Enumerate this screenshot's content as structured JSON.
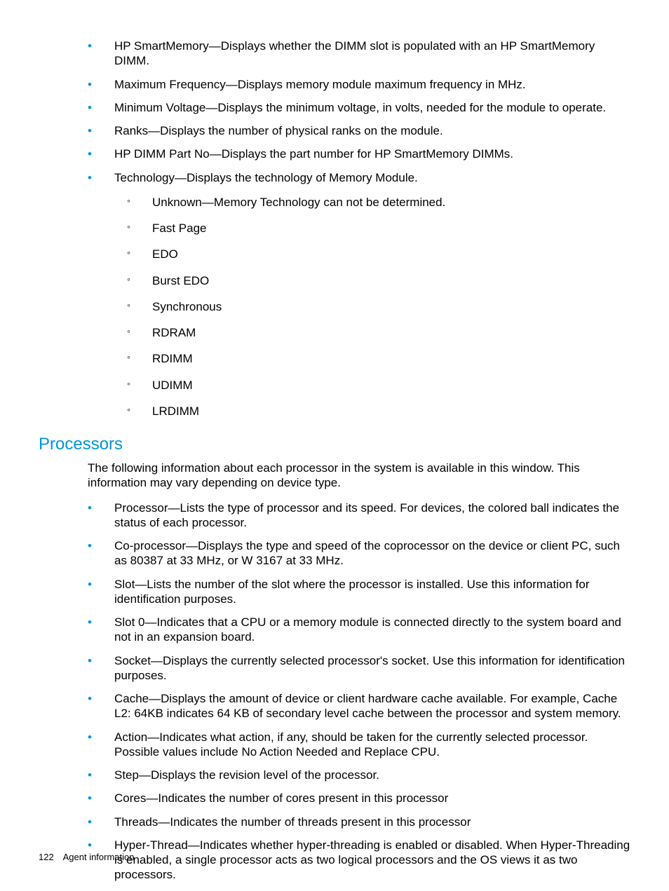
{
  "section1_items": [
    "HP SmartMemory—Displays whether the DIMM slot is populated with an HP SmartMemory DIMM.",
    "Maximum Frequency—Displays memory module maximum frequency in MHz.",
    "Minimum Voltage—Displays the minimum voltage, in volts, needed for the module to operate.",
    "Ranks—Displays the number of physical ranks on the module.",
    "HP DIMM Part No—Displays the part number for HP SmartMemory DIMMs.",
    "Technology—Displays the technology of Memory Module."
  ],
  "technology_subitems": [
    "Unknown—Memory Technology can not be determined.",
    "Fast Page",
    "EDO",
    "Burst EDO",
    "Synchronous",
    "RDRAM",
    "RDIMM",
    "UDIMM",
    "LRDIMM"
  ],
  "section2_heading": "Processors",
  "section2_intro": "The following information about each processor in the system is available in this window. This information may vary depending on device type.",
  "section2_items": [
    "Processor—Lists the type of processor and its speed. For devices, the colored ball indicates the status of each processor.",
    "Co-processor—Displays the type and speed of the coprocessor on the device or client PC, such as 80387 at 33 MHz, or W 3167 at 33 MHz.",
    "Slot—Lists the number of the slot where the processor is installed. Use this information for identification purposes.",
    "Slot 0—Indicates that a CPU or a memory module is connected directly to the system board and not in an expansion board.",
    "Socket—Displays the currently selected processor's socket. Use this information for identification purposes.",
    "Cache—Displays the amount of device or client hardware cache available. For example, Cache L2: 64KB indicates 64 KB of secondary level cache between the processor and system memory.",
    "Action—Indicates what action, if any, should be taken for the currently selected processor. Possible values include No Action Needed and Replace CPU.",
    "Step—Displays the revision level of the processor.",
    "Cores—Indicates the number of cores present in this processor",
    "Threads—Indicates the number of threads present in this processor",
    "Hyper-Thread—Indicates whether hyper-threading is enabled or disabled. When Hyper-Threading is enabled, a single processor acts as two logical processors and the OS views it as two processors."
  ],
  "footer_page": "122",
  "footer_text": "Agent information"
}
